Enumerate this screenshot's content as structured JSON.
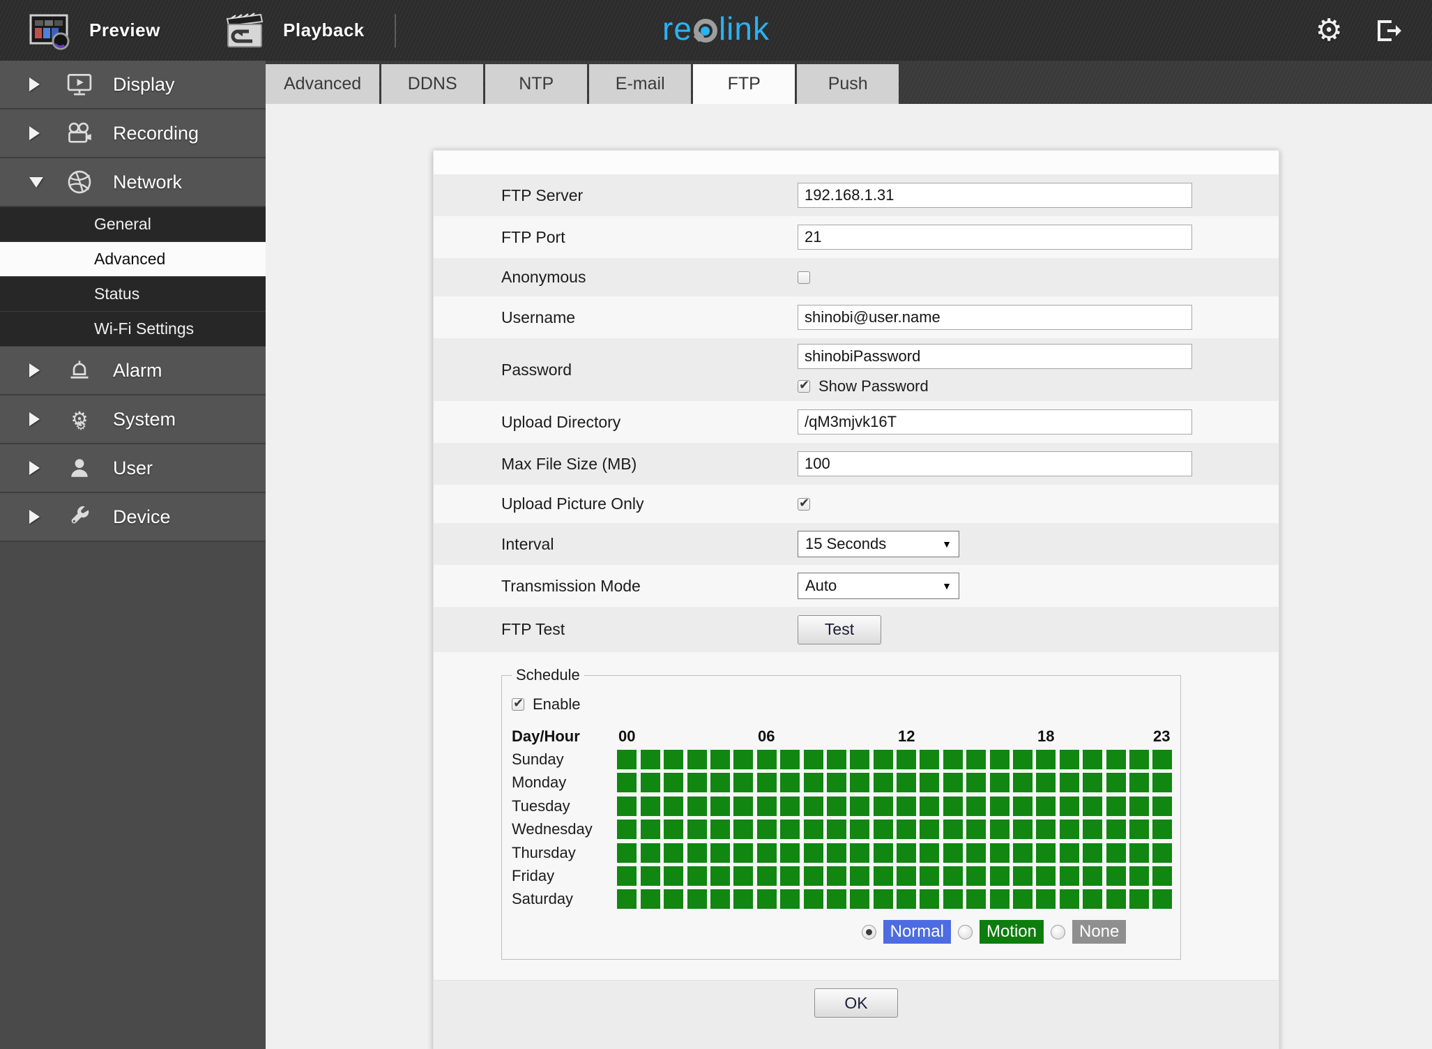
{
  "header": {
    "nav": [
      {
        "label": "Preview",
        "icon": "preview-monitor-icon"
      },
      {
        "label": "Playback",
        "icon": "playback-clapper-icon"
      }
    ],
    "brand_re": "re",
    "brand_link": "link",
    "settings_icon": "gear-icon",
    "logout_icon": "logout-icon",
    "gear_glyph": "⚙"
  },
  "sidebar": {
    "items": [
      {
        "label": "Display",
        "icon": "display-icon"
      },
      {
        "label": "Recording",
        "icon": "recording-icon"
      },
      {
        "label": "Network",
        "icon": "network-icon",
        "expanded": true,
        "children": [
          {
            "label": "General"
          },
          {
            "label": "Advanced",
            "selected": true
          },
          {
            "label": "Status"
          },
          {
            "label": "Wi-Fi Settings"
          }
        ]
      },
      {
        "label": "Alarm",
        "icon": "alarm-icon"
      },
      {
        "label": "System",
        "icon": "system-icon",
        "gear_glyph": "⚙"
      },
      {
        "label": "User",
        "icon": "user-icon"
      },
      {
        "label": "Device",
        "icon": "device-icon"
      }
    ]
  },
  "tabs": {
    "items": [
      "Advanced",
      "DDNS",
      "NTP",
      "E-mail",
      "FTP",
      "Push"
    ],
    "active": "FTP"
  },
  "form": {
    "ftp_server": {
      "label": "FTP Server",
      "value": "192.168.1.31"
    },
    "ftp_port": {
      "label": "FTP Port",
      "value": "21"
    },
    "anonymous": {
      "label": "Anonymous",
      "checked": false
    },
    "username": {
      "label": "Username",
      "value": "shinobi@user.name"
    },
    "password": {
      "label": "Password",
      "value": "shinobiPassword",
      "show_password_label": "Show Password",
      "show_password_checked": true
    },
    "upload_directory": {
      "label": "Upload Directory",
      "value": "/qM3mjvk16T"
    },
    "max_file_size": {
      "label": "Max File Size (MB)",
      "value": "100"
    },
    "upload_picture_only": {
      "label": "Upload Picture Only",
      "checked": true
    },
    "interval": {
      "label": "Interval",
      "value": "15 Seconds"
    },
    "transmission_mode": {
      "label": "Transmission Mode",
      "value": "Auto"
    },
    "ftp_test": {
      "label": "FTP Test",
      "button_label": "Test"
    },
    "ok_label": "OK"
  },
  "schedule": {
    "title": "Schedule",
    "enable_label": "Enable",
    "enable_checked": true,
    "corner_label": "Day/Hour",
    "hour_labels": [
      "00",
      "06",
      "12",
      "18",
      "23"
    ],
    "days": [
      "Sunday",
      "Monday",
      "Tuesday",
      "Wednesday",
      "Thursday",
      "Friday",
      "Saturday"
    ],
    "columns": 24,
    "cell_state_all": "Normal",
    "cell_color": "#118611",
    "modes": [
      {
        "label": "Normal",
        "selected": true,
        "color": "#4d6ce2"
      },
      {
        "label": "Motion",
        "selected": false,
        "color": "#0d7d0d"
      },
      {
        "label": "None",
        "selected": false,
        "color": "#8f8f8f"
      }
    ]
  }
}
